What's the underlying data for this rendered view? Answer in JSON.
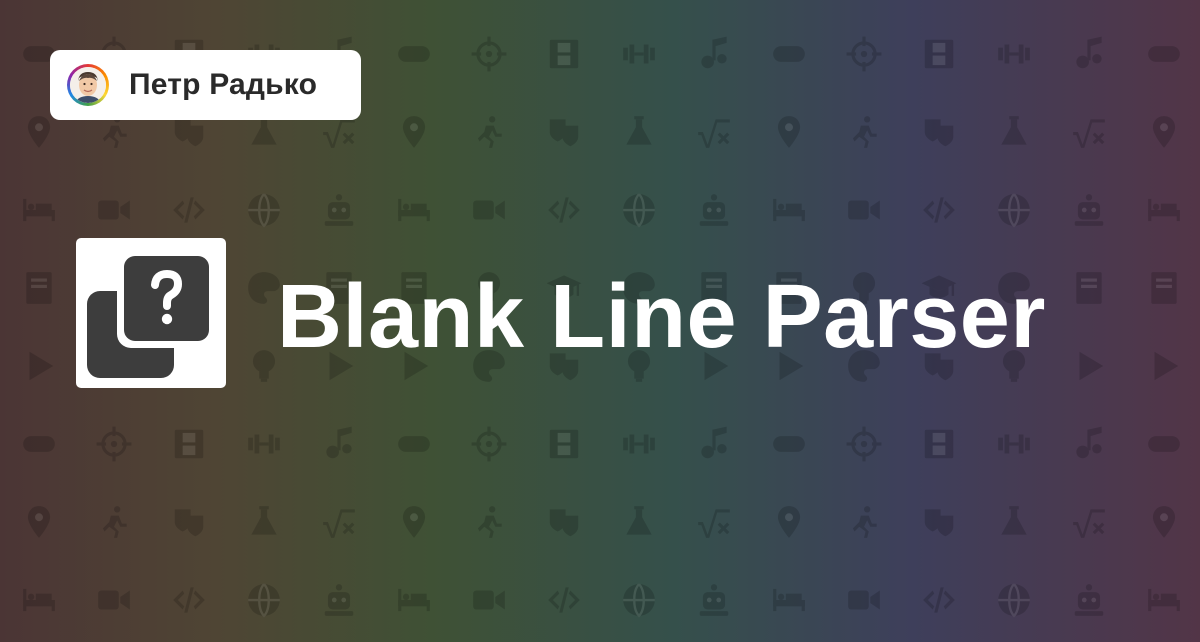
{
  "author": {
    "name": "Петр Радько",
    "avatar_icon": "author-photo-avatar"
  },
  "logo": {
    "icon": "question-cards-icon"
  },
  "title": "Blank Line Parser",
  "background": {
    "gradient": [
      "#4b3535",
      "#4f4534",
      "#3f5135",
      "#35504b",
      "#3e3f5b",
      "#523547"
    ],
    "pattern_icon_names": [
      "gamepad-icon",
      "crosshair-icon",
      "film-icon",
      "dumbbell-icon",
      "music-note-icon",
      "map-pin-icon",
      "running-person-icon",
      "theater-masks-icon",
      "flask-icon",
      "square-root-icon",
      "bed-icon",
      "video-camera-icon",
      "code-icon",
      "globe-icon",
      "robot-icon",
      "book-icon",
      "lightbulb-icon",
      "graduation-cap-icon",
      "palette-icon",
      "play-icon"
    ]
  }
}
